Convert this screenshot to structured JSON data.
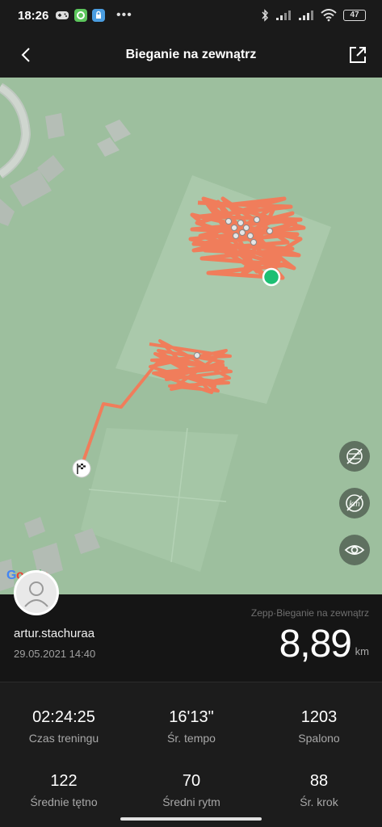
{
  "status": {
    "time": "18:26",
    "battery": "47",
    "more": "•••"
  },
  "header": {
    "title": "Bieganie na zewnątrz"
  },
  "map": {
    "attribution": "Google",
    "controls": [
      {
        "icon": "satellite-off-icon"
      },
      {
        "icon": "km-markers-off-icon"
      },
      {
        "icon": "eye-icon"
      }
    ],
    "route_color": "#f07d5b",
    "start_color": "#1dbf73"
  },
  "workout": {
    "username": "artur.stachuraa",
    "datetime": "29.05.2021 14:40",
    "activity": "Zepp·Bieganie na zewnątrz",
    "distance": "8,89",
    "unit": "km"
  },
  "stats": [
    {
      "value": "02:24:25",
      "label": "Czas treningu"
    },
    {
      "value": "16'13\"",
      "label": "Śr. tempo"
    },
    {
      "value": "1203",
      "label": "Spalono"
    },
    {
      "value": "122",
      "label": "Średnie tętno"
    },
    {
      "value": "70",
      "label": "Średni rytm"
    },
    {
      "value": "88",
      "label": "Śr. krok"
    }
  ]
}
